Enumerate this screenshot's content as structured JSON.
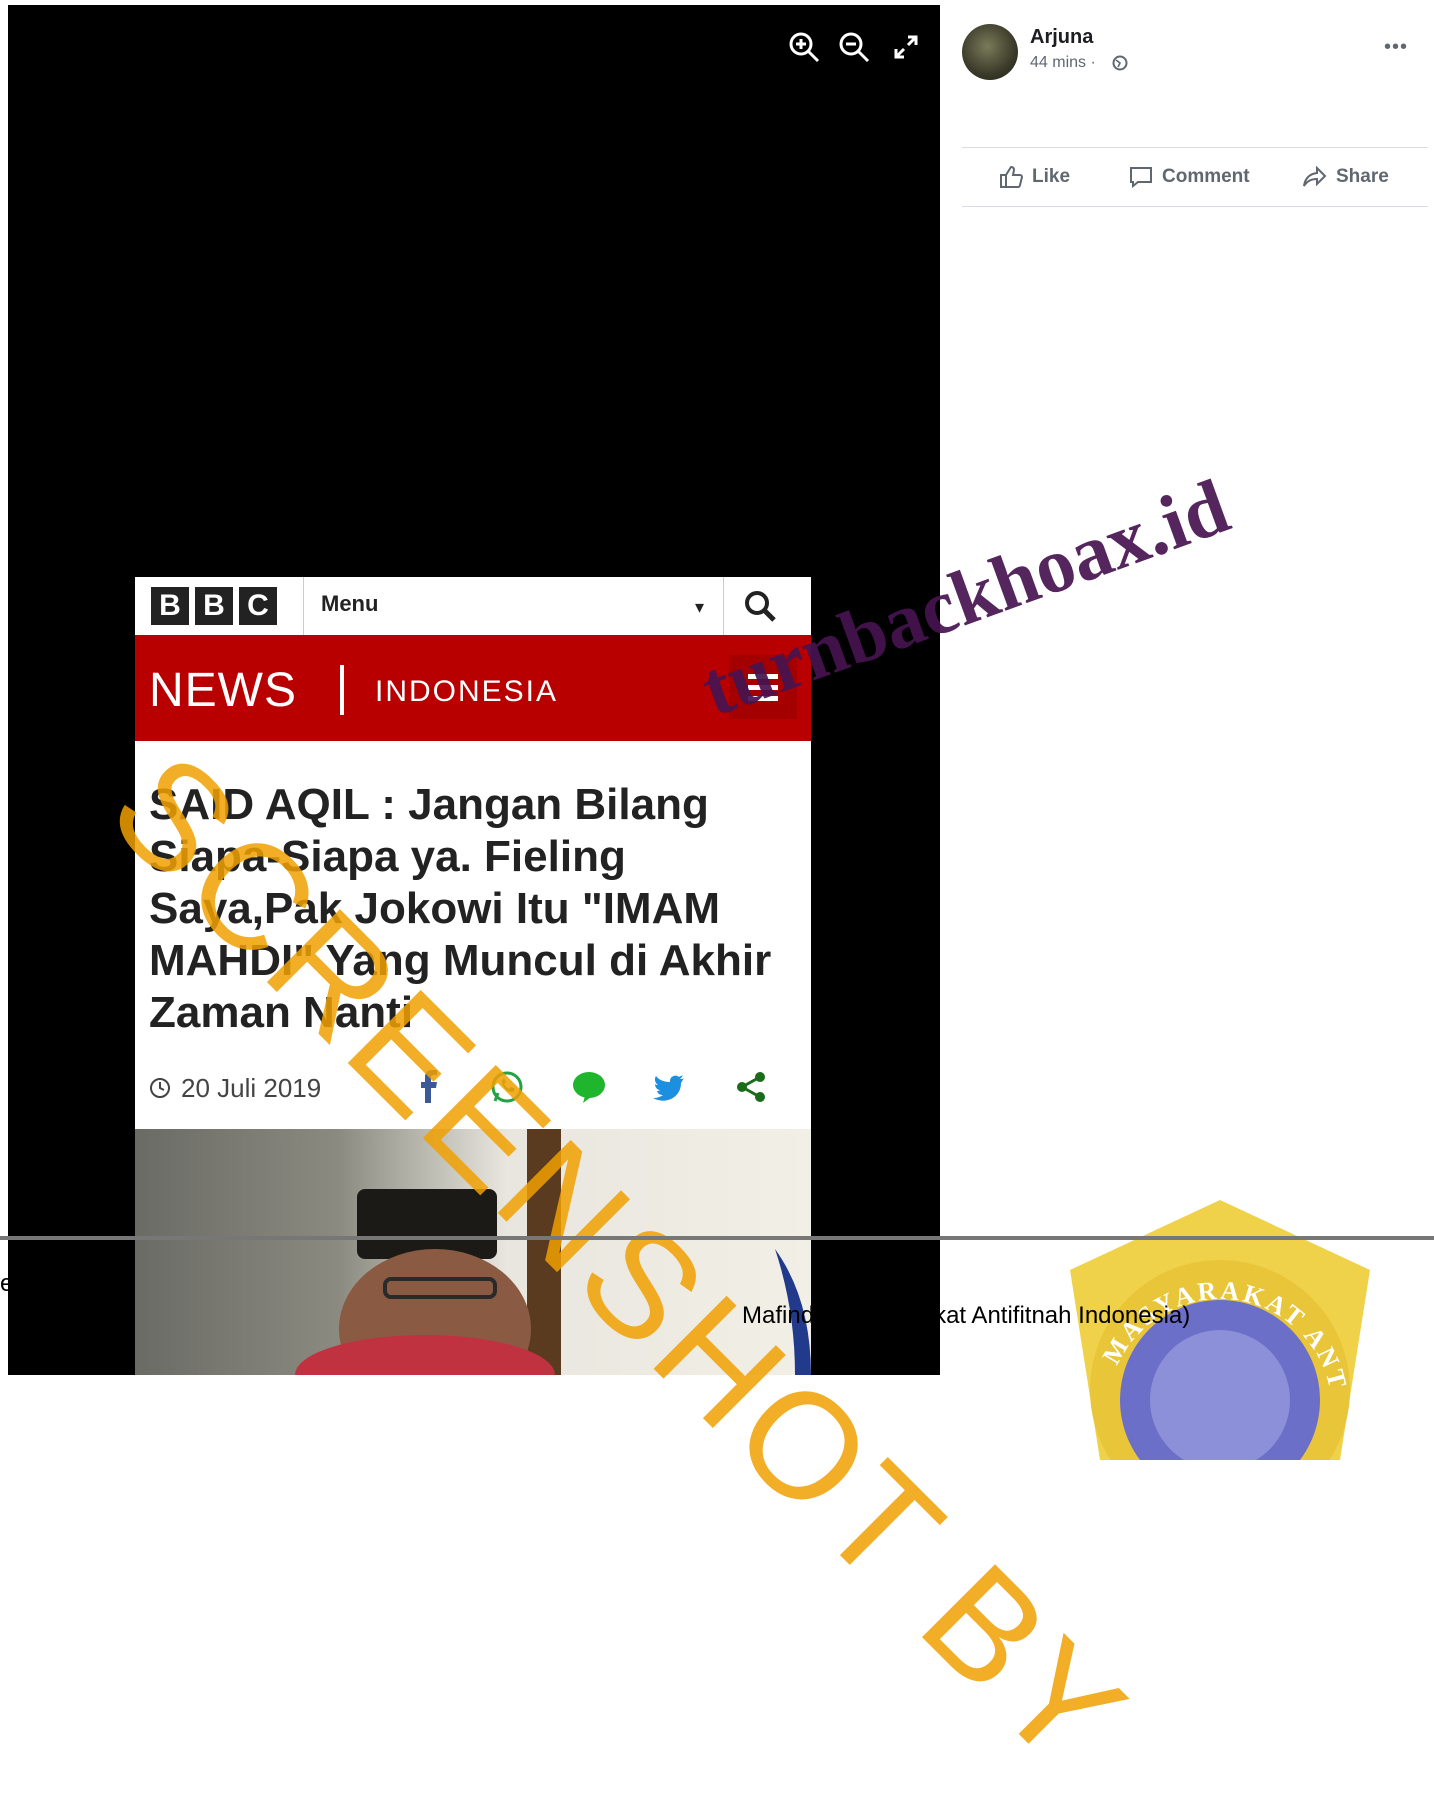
{
  "viewer": {
    "zoom_in_icon": "zoom-in-icon",
    "zoom_out_icon": "zoom-out-icon",
    "fullscreen_icon": "expand-icon"
  },
  "article": {
    "brand_letters": [
      "B",
      "B",
      "C"
    ],
    "menu_label": "Menu",
    "news_word": "NEWS",
    "news_region": "INDONESIA",
    "headline": "SAID AQIL : Jangan Bilang Siapa-Siapa ya. Fieling Saya,Pak Jokowi Itu \"IMAM MAHDI\" Yang Muncul di Akhir Zaman Nanti",
    "date": "20 Juli 2019",
    "share_icons": [
      "facebook-icon",
      "whatsapp-icon",
      "line-icon",
      "twitter-icon",
      "share-icon"
    ]
  },
  "post": {
    "author": "Arjuna",
    "time": "44 mins ·",
    "actions": {
      "like": "Like",
      "comment": "Comment",
      "share": "Share"
    }
  },
  "watermarks": {
    "screenshot_by": "SCREENSHOT BY",
    "site": "turnbackhoax.id"
  },
  "footer": {
    "left_fragment": "e",
    "caption": "Mafindo (Masyarakat Antifitnah Indonesia)"
  },
  "colors": {
    "bbc_red": "#b80000",
    "watermark_orange": "#f0a000",
    "facebook_gray": "#606770"
  }
}
